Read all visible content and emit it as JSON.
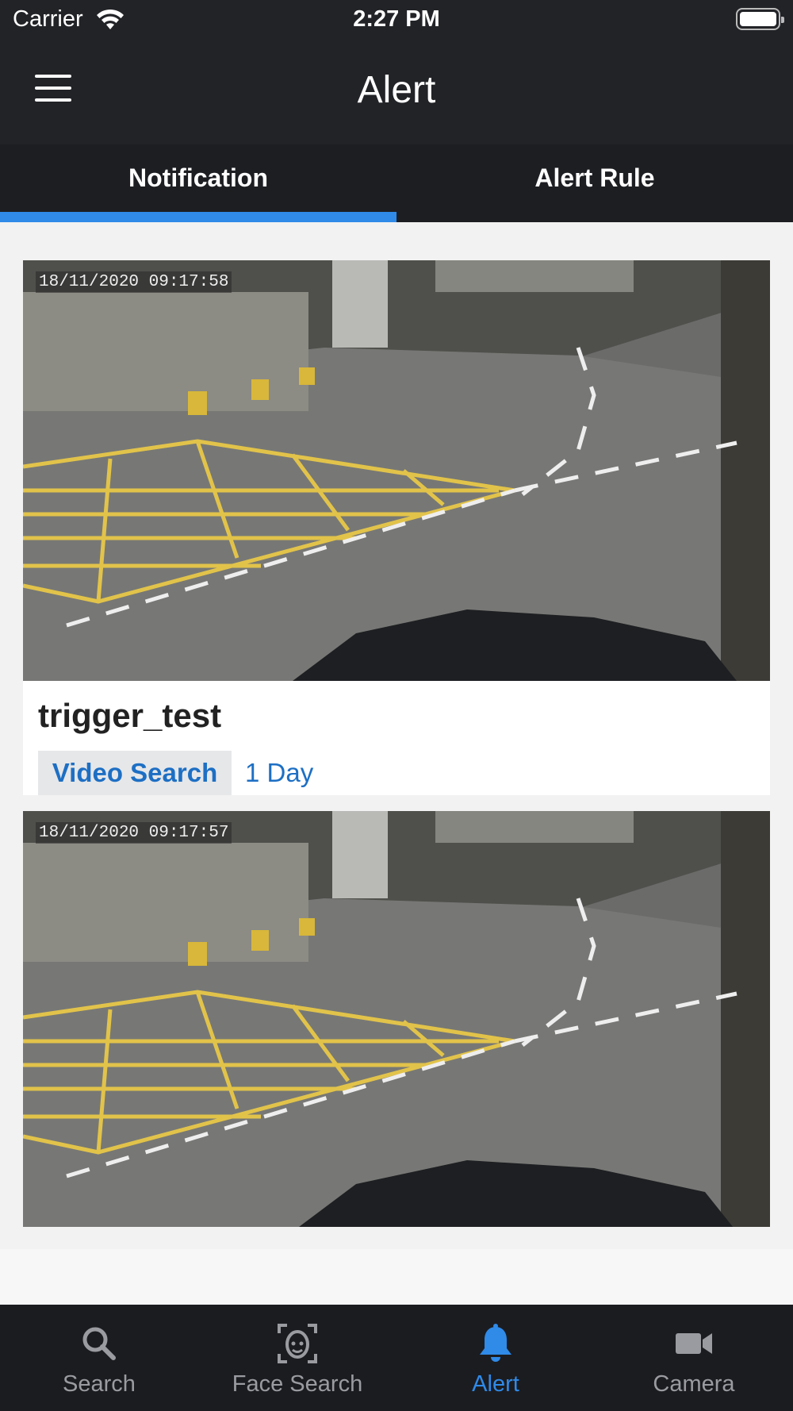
{
  "status_bar": {
    "carrier": "Carrier",
    "time": "2:27 PM"
  },
  "header": {
    "title": "Alert",
    "menu_icon": "hamburger-menu-icon"
  },
  "tabs": [
    {
      "label": "Notification",
      "active": true
    },
    {
      "label": "Alert Rule",
      "active": false
    }
  ],
  "notifications": [
    {
      "timestamp": "18/11/2020 09:17:58",
      "title": "trigger_test",
      "action_label": "Video Search",
      "duration": "1 Day"
    },
    {
      "timestamp": "18/11/2020 09:17:57"
    }
  ],
  "tab_bar": [
    {
      "label": "Search",
      "icon": "search-icon",
      "active": false
    },
    {
      "label": "Face Search",
      "icon": "face-scan-icon",
      "active": false
    },
    {
      "label": "Alert",
      "icon": "bell-icon",
      "active": true
    },
    {
      "label": "Camera",
      "icon": "video-camera-icon",
      "active": false
    }
  ],
  "colors": {
    "header_bg": "#222327",
    "accent": "#2f8ae8",
    "link_text": "#1d6fc4",
    "tab_inactive": "#9a9ba0"
  }
}
